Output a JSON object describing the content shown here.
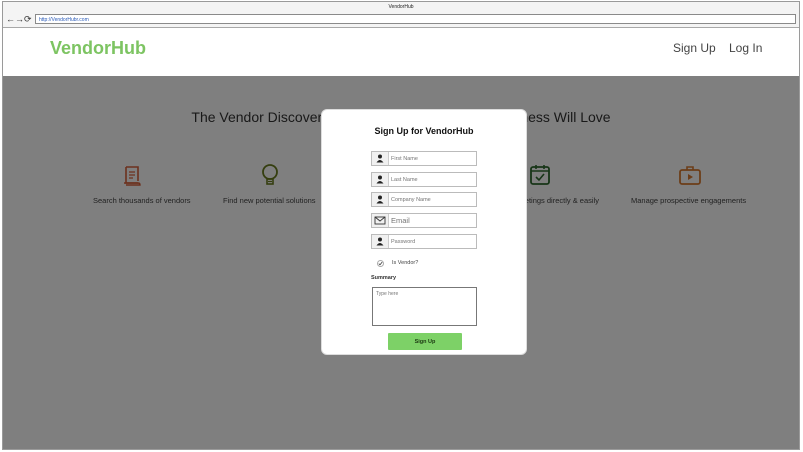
{
  "window": {
    "title": "VendorHub",
    "url": "http://VendorHubr.com"
  },
  "header": {
    "brand": "VendorHub",
    "signup_link": "Sign Up",
    "login_link": "Log In"
  },
  "hero": {
    "tagline": "The Vendor Discovery & Management Tool Your Business Will Love"
  },
  "features": [
    {
      "label": "Search thousands of vendors",
      "icon": "scroll-icon"
    },
    {
      "label": "Find new potential solutions",
      "icon": "lightbulb-icon"
    },
    {
      "label": "Schedule meetings directly & easily",
      "icon": "calendar-icon"
    },
    {
      "label": "Manage prospective engagements",
      "icon": "briefcase-icon"
    }
  ],
  "modal": {
    "title": "Sign Up for VendorHub",
    "fields": {
      "first_name": "First Name",
      "last_name": "Last Name",
      "company_name": "Company Name",
      "email": "Email",
      "password": "Password"
    },
    "vendor_checkbox": "Is Vendor?",
    "summary_label": "Summary",
    "summary_placeholder": "Type here",
    "submit": "Sign Up"
  },
  "colors": {
    "brand": "#7dc462",
    "button": "#7dd167",
    "icon_scroll": "#d9603b",
    "icon_bulb": "#6a7d1e",
    "icon_calendar": "#2e6b2e",
    "icon_briefcase": "#d97a30",
    "overlay": "rgba(0,0,0,0.5)"
  }
}
